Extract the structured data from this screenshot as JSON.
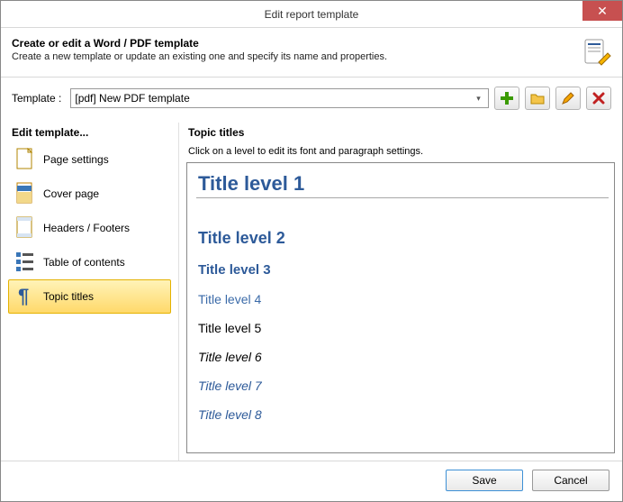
{
  "window": {
    "title": "Edit report template"
  },
  "header": {
    "title": "Create or edit a Word / PDF template",
    "subtitle": "Create a new template or update an existing one and specify its name and properties."
  },
  "template_row": {
    "label": "Template :",
    "selected": "[pdf] New PDF template"
  },
  "toolbar_icons": {
    "add": "add-icon",
    "open": "folder-icon",
    "edit": "pencil-icon",
    "delete": "x-icon"
  },
  "sidebar": {
    "title": "Edit template...",
    "items": [
      {
        "label": "Page settings",
        "icon": "page-icon"
      },
      {
        "label": "Cover page",
        "icon": "cover-icon"
      },
      {
        "label": "Headers / Footers",
        "icon": "header-footer-icon"
      },
      {
        "label": "Table of contents",
        "icon": "toc-icon"
      },
      {
        "label": "Topic titles",
        "icon": "pilcrow-icon"
      }
    ],
    "selected_index": 4
  },
  "content": {
    "title": "Topic titles",
    "subtitle": "Click on a level to edit its font and paragraph settings.",
    "levels": [
      "Title level 1",
      "Title level 2",
      "Title level 3",
      "Title level 4",
      "Title level 5",
      "Title level 6",
      "Title level 7",
      "Title level 8"
    ]
  },
  "footer": {
    "save": "Save",
    "cancel": "Cancel"
  }
}
